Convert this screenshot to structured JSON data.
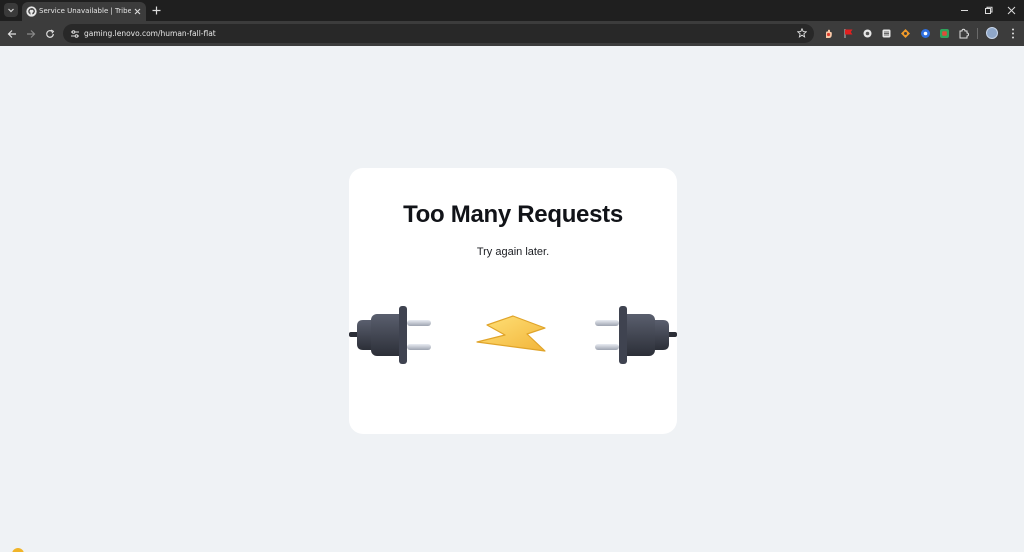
{
  "browser": {
    "tab": {
      "title": "Service Unavailable | Tribe",
      "favicon": "github-icon"
    },
    "url": "gaming.lenovo.com/human-fall-flat",
    "extensions": [
      "hand-icon",
      "red-flag-icon",
      "circle-icon",
      "stack-icon",
      "orange-badge-icon",
      "blue-dot-icon",
      "green-square-icon",
      "puzzle-icon"
    ],
    "profile_initial": "D"
  },
  "page": {
    "title": "Too Many Requests",
    "subtitle": "Try again later."
  },
  "illustration": {
    "left": "electric-plug-icon",
    "middle": "lightning-bolt-icon",
    "right": "electric-plug-icon"
  },
  "colors": {
    "page_bg": "#eff2f5",
    "card_bg": "#ffffff",
    "plug_body": "#3f4350",
    "bolt": "#f6c445"
  }
}
